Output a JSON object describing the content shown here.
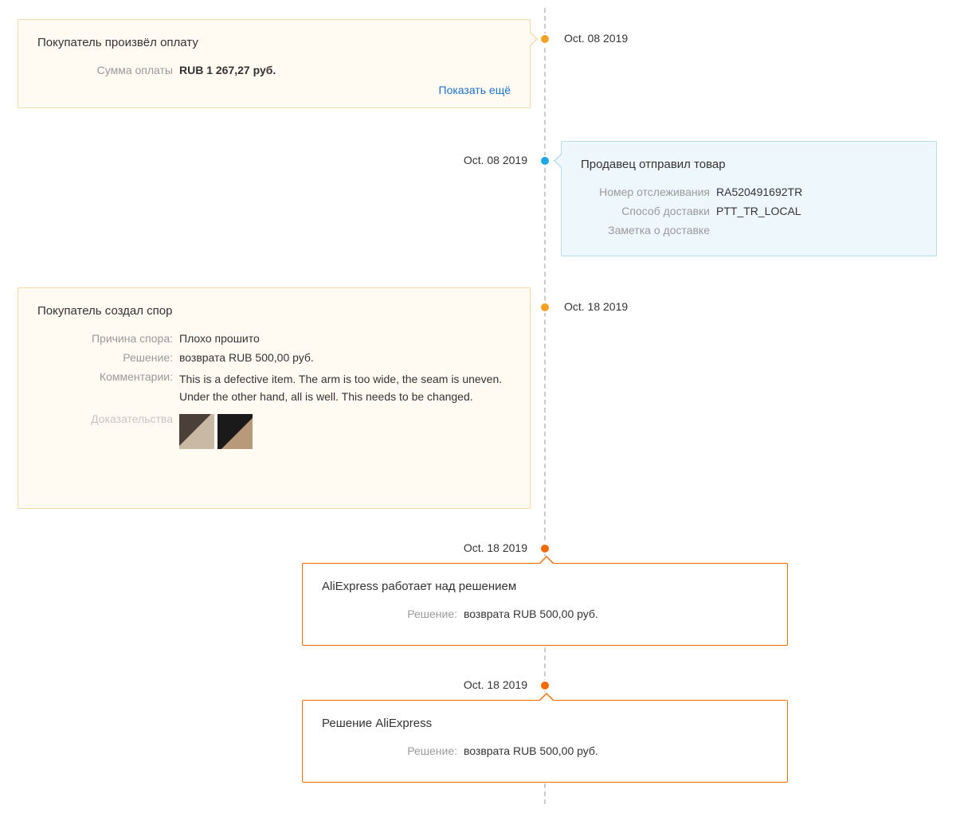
{
  "events": {
    "payment": {
      "date": "Oct. 08 2019",
      "title": "Покупатель произвёл оплату",
      "amount_label": "Сумма оплаты",
      "amount_value": "RUB 1 267,27 руб.",
      "show_more": "Показать ещё"
    },
    "shipped": {
      "date": "Oct. 08 2019",
      "title": "Продавец отправил товар",
      "tracking_label": "Номер отслеживания",
      "tracking_value": "RA520491692TR",
      "method_label": "Способ доставки",
      "method_value": "PTT_TR_LOCAL",
      "note_label": "Заметка о доставке",
      "note_value": ""
    },
    "dispute": {
      "date": "Oct. 18 2019",
      "title": "Покупатель создал спор",
      "reason_label": "Причина спора:",
      "reason_value": "Плохо прошито",
      "solution_label": "Решение:",
      "solution_value": "возврата RUB 500,00 руб.",
      "comments_label": "Комментарии:",
      "comments_value": "This is a defective item. The arm is too wide, the seam is uneven. Under the other hand, all is well. This needs to be changed.",
      "evidence_label": "Доказательства"
    },
    "processing": {
      "date": "Oct. 18 2019",
      "title": "AliExpress работает над решением",
      "solution_label": "Решение:",
      "solution_value": "возврата RUB 500,00 руб."
    },
    "decision": {
      "date": "Oct. 18 2019",
      "title": "Решение AliExpress",
      "solution_label": "Решение:",
      "solution_value": "возврата RUB 500,00 руб."
    }
  }
}
